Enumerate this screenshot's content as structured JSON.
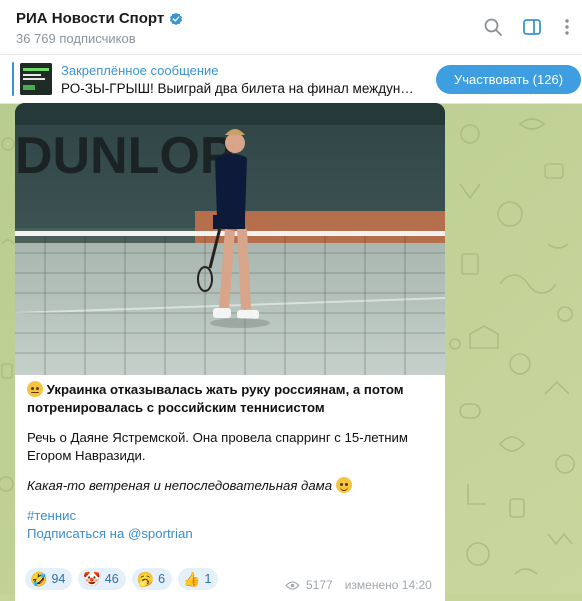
{
  "header": {
    "channel_name": "РИА Новости Спорт",
    "subscribers": "36 769 подписчиков",
    "icons": [
      "verified-badge-icon",
      "search-icon",
      "sidebar-toggle-icon",
      "more-vertical-icon"
    ]
  },
  "pinned": {
    "label": "Закреплённое сообщение",
    "text": "РО-ЗЫ-ГРЫШ! Выиграй два билета на финал междун…",
    "button_label": "Участвовать (126)"
  },
  "post": {
    "headline_emoji": "😑",
    "headline": "Украинка отказывалась жать руку россиянам, а потом потренировалась с российским теннисистом",
    "body": "Речь о Даяне Ястремской. Она провела спарринг с 15-летним Егором Навразиди.",
    "comment": "Какая-то ветреная и непоследовательная дама",
    "comment_emoji": "😅",
    "hashtag": "#теннис",
    "subscribe_link": "Подписаться на @sportrian",
    "photo_banner_text": "DUNLOP",
    "views": "5177",
    "edited": "изменено 14:20",
    "reactions": [
      {
        "emoji": "🤣",
        "count": "94"
      },
      {
        "emoji": "🤡",
        "count": "46"
      },
      {
        "emoji": "🥱",
        "count": "6"
      },
      {
        "emoji": "👍",
        "count": "1"
      }
    ]
  },
  "colors": {
    "accent": "#3a94d4",
    "chat_background": "#c3d49a",
    "button": "#3f9ee0"
  }
}
